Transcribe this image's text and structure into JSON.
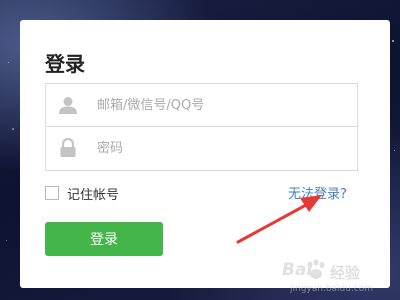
{
  "dialog": {
    "title": "登录",
    "username": {
      "placeholder": "邮箱/微信号/QQ号",
      "icon": "user-icon"
    },
    "password": {
      "placeholder": "密码",
      "icon": "lock-icon"
    },
    "remember_label": "记住帐号",
    "remember_checked": false,
    "cant_login_link": "无法登录?",
    "login_button": "登录"
  },
  "colors": {
    "primary_button": "#44b549",
    "link": "#3f7fbf",
    "annotation_arrow": "#e53935"
  },
  "watermark": {
    "brand": "Bai",
    "brand_suffix": "经验",
    "url": "jingyan.baidu.com"
  }
}
